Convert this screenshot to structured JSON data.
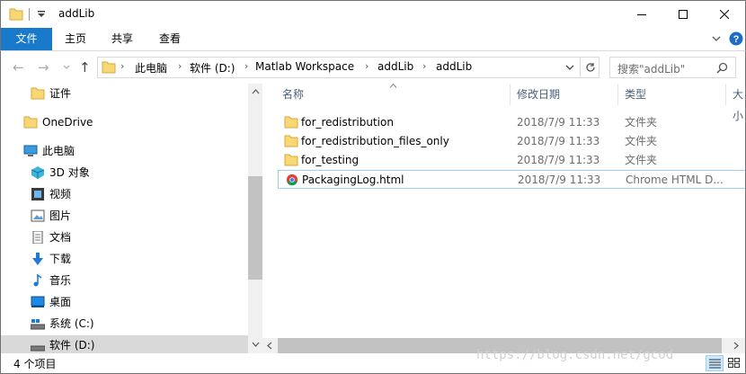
{
  "window": {
    "title": "addLib"
  },
  "ribbon": {
    "tabs": [
      "文件",
      "主页",
      "共享",
      "查看"
    ]
  },
  "address": {
    "crumbs": [
      "此电脑",
      "软件 (D:)",
      "Matlab Workspace",
      "addLib",
      "addLib"
    ],
    "search_placeholder": "搜索\"addLib\""
  },
  "nav": {
    "items": [
      {
        "label": "证件",
        "icon": "folder-icon"
      },
      {
        "label": "OneDrive",
        "icon": "folder-icon"
      },
      {
        "label": "此电脑",
        "icon": "computer-icon"
      },
      {
        "label": "3D 对象",
        "icon": "3d-objects-icon"
      },
      {
        "label": "视频",
        "icon": "video-icon"
      },
      {
        "label": "图片",
        "icon": "pictures-icon"
      },
      {
        "label": "文档",
        "icon": "documents-icon"
      },
      {
        "label": "下载",
        "icon": "download-icon"
      },
      {
        "label": "音乐",
        "icon": "music-icon"
      },
      {
        "label": "桌面",
        "icon": "desktop-icon"
      },
      {
        "label": "系统 (C:)",
        "icon": "drive-icon"
      },
      {
        "label": "软件 (D:)",
        "icon": "drive-icon"
      }
    ]
  },
  "columns": {
    "name": "名称",
    "modified": "修改日期",
    "type": "类型",
    "size": "大小"
  },
  "files": [
    {
      "name": "for_redistribution",
      "modified": "2018/7/9 11:33",
      "type": "文件夹",
      "icon": "folder-icon"
    },
    {
      "name": "for_redistribution_files_only",
      "modified": "2018/7/9 11:33",
      "type": "文件夹",
      "icon": "folder-icon"
    },
    {
      "name": "for_testing",
      "modified": "2018/7/9 11:33",
      "type": "文件夹",
      "icon": "folder-icon"
    },
    {
      "name": "PackagingLog.html",
      "modified": "2018/7/9 11:33",
      "type": "Chrome HTML D...",
      "icon": "chrome-icon"
    }
  ],
  "status": {
    "item_count": "4 个项目"
  },
  "watermark": "https://blog.csdn.net/gcod",
  "colors": {
    "accent": "#1979ca",
    "folder": "#f8d775",
    "selected": "#d9d9d9"
  }
}
